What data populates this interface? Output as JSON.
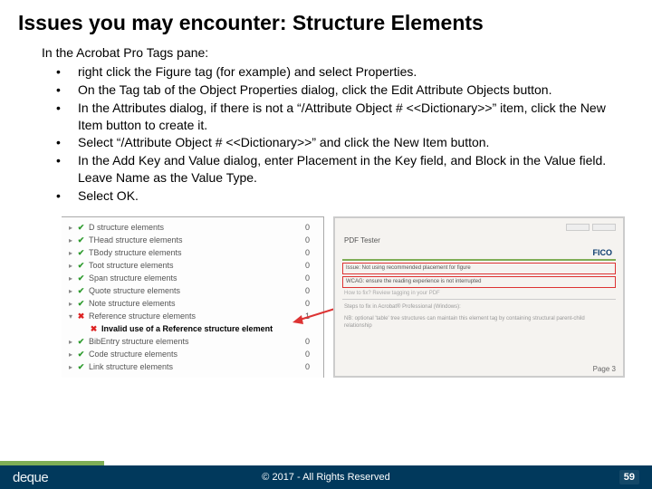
{
  "title": "Issues you may encounter: Structure Elements",
  "intro": "In the Acrobat Pro Tags pane:",
  "bullets": [
    "right click the Figure tag (for example) and select Properties.",
    "On the Tag tab of the Object Properties dialog, click the Edit Attribute Objects button.",
    "In the Attributes dialog, if there is not a “/Attribute Object # <<Dictionary>>” item, click the New Item button to create it.",
    "Select “/Attribute Object #   <<Dictionary>>” and click the New Item button.",
    "In the Add Key and Value dialog, enter Placement in the Key field, and Block in the Value field. Leave Name as the Value Type.",
    "Select OK."
  ],
  "leftpanel": [
    {
      "icon": "ok",
      "text": "D structure elements",
      "count": "0",
      "tri": "▸"
    },
    {
      "icon": "ok",
      "text": "THead structure elements",
      "count": "0",
      "tri": "▸"
    },
    {
      "icon": "ok",
      "text": "TBody structure elements",
      "count": "0",
      "tri": "▸"
    },
    {
      "icon": "ok",
      "text": "Toot structure elements",
      "count": "0",
      "tri": "▸"
    },
    {
      "icon": "ok",
      "text": "Span structure elements",
      "count": "0",
      "tri": "▸"
    },
    {
      "icon": "ok",
      "text": "Quote structure elements",
      "count": "0",
      "tri": "▸"
    },
    {
      "icon": "ok",
      "text": "Note structure elements",
      "count": "0",
      "tri": "▸"
    },
    {
      "icon": "bad",
      "text": "Reference structure elements",
      "count": "1",
      "tri": "▾",
      "bold": false
    },
    {
      "icon": "bad",
      "text": "Invalid use of a Reference structure element",
      "count": "",
      "tri": "",
      "indent": 1,
      "bold": true
    },
    {
      "icon": "ok",
      "text": "BibEntry structure elements",
      "count": "0",
      "tri": "▸"
    },
    {
      "icon": "ok",
      "text": "Code structure elements",
      "count": "0",
      "tri": "▸"
    },
    {
      "icon": "ok",
      "text": "Link structure elements",
      "count": "0",
      "tri": "▸"
    }
  ],
  "rightpanel": {
    "title": "PDF Tester",
    "brand": "FICO",
    "red1": "Issue: Not using recommended placement for figure",
    "red2": "WCAG: ensure the reading experience is not interrupted",
    "line1": "How to fix? Review tagging in your PDF",
    "block1": "Steps to fix in Acrobat® Professional (Windows):",
    "block2": "NB: optional 'table' tree structures can maintain this element tag by containing structural parent-child relationship",
    "pagen": "Page 3"
  },
  "footer": {
    "logo": "deque",
    "copyright": "© 2017 - All Rights Reserved",
    "page": "59"
  }
}
